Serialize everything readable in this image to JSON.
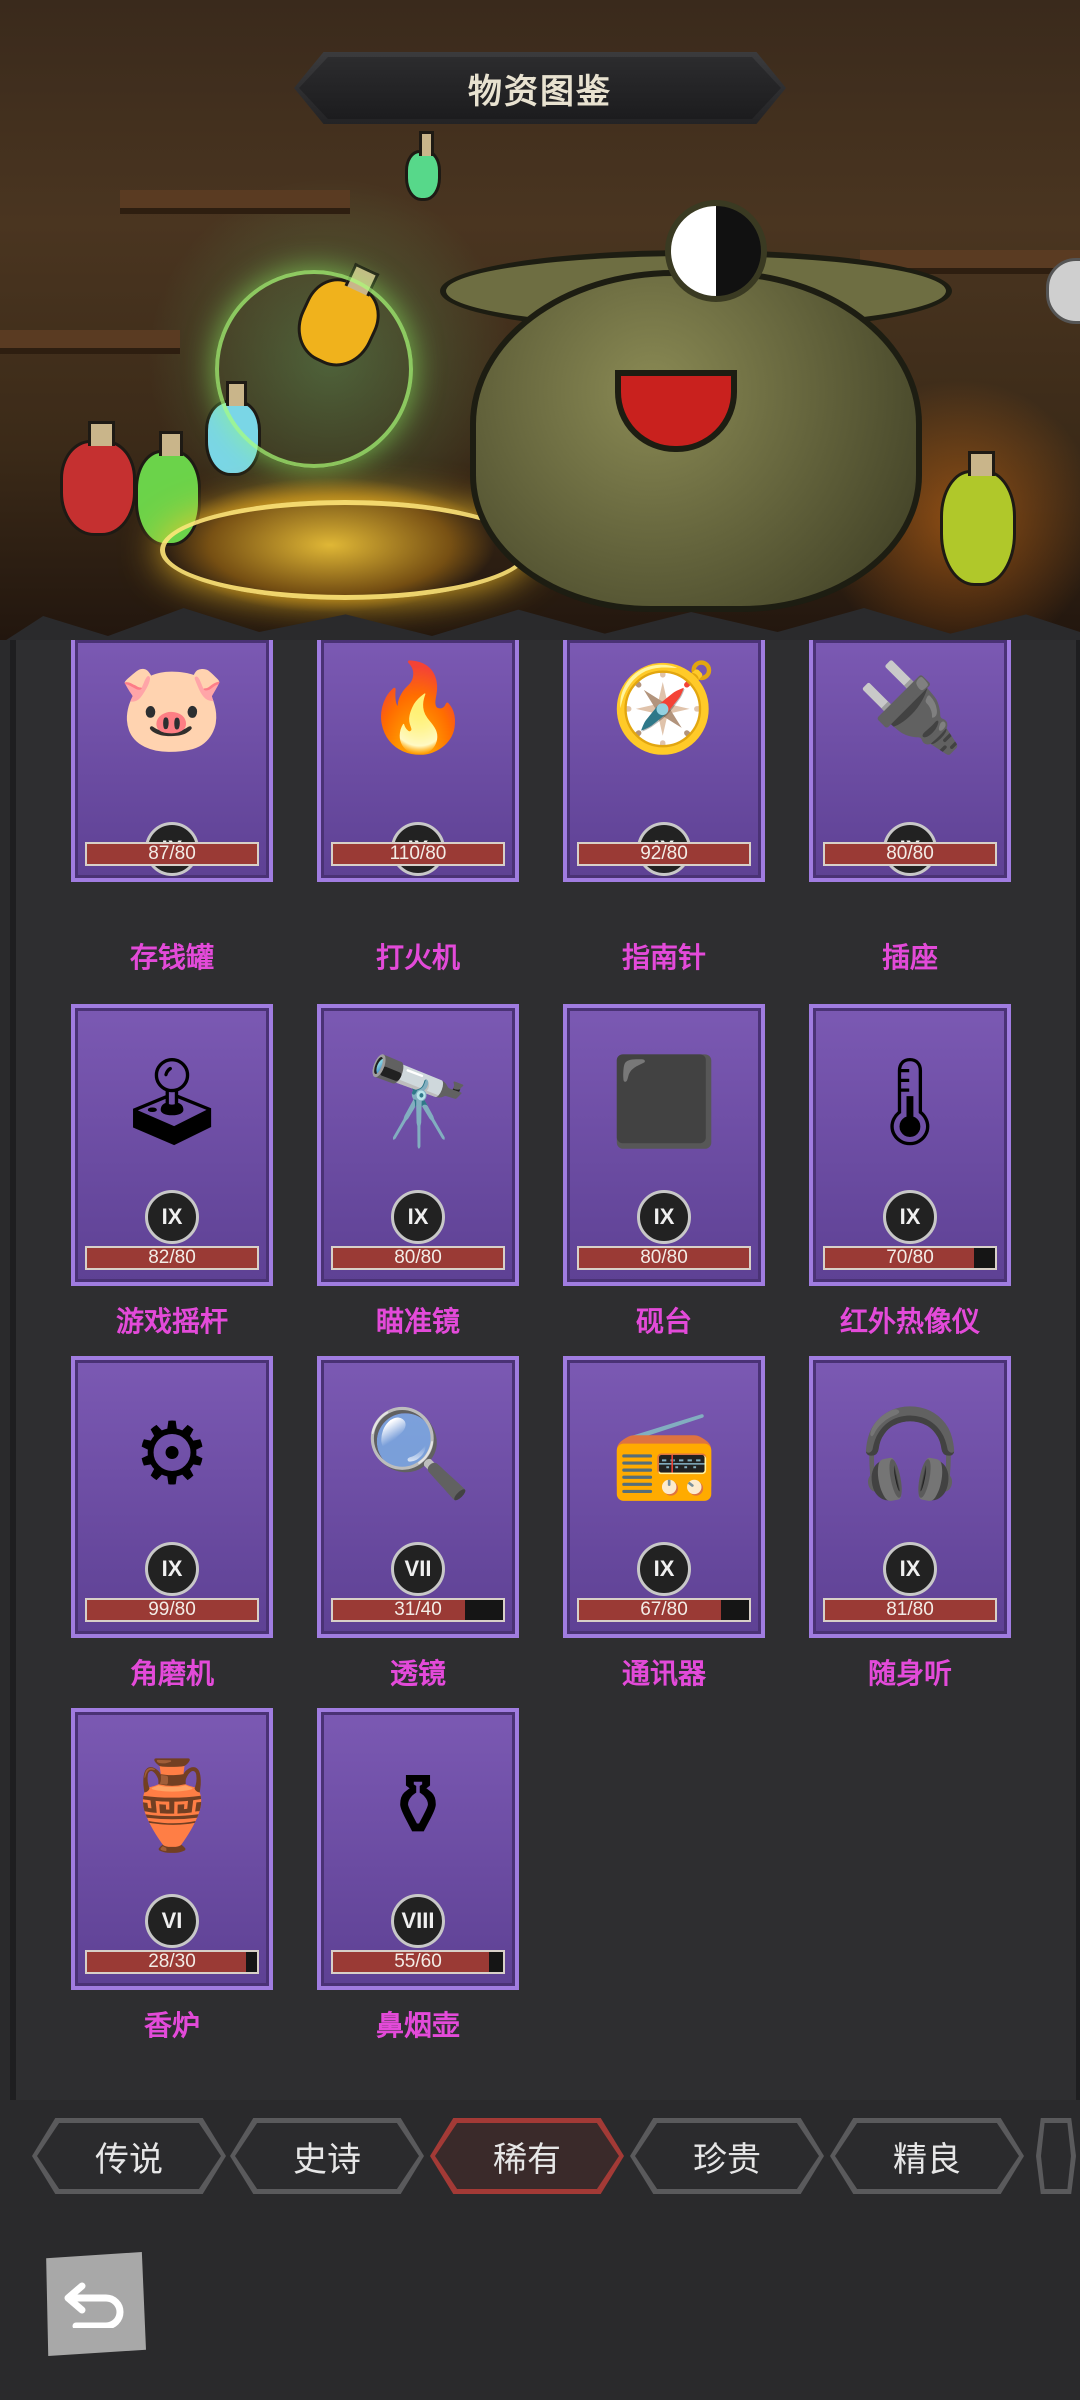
{
  "header": {
    "title": "物资图鉴"
  },
  "items": [
    {
      "name": "存钱罐",
      "tier": "IX",
      "progress": "87/80",
      "current": 87,
      "max": 80,
      "icon": "piggy-bank-icon",
      "glyph": "🐷"
    },
    {
      "name": "打火机",
      "tier": "IX",
      "progress": "110/80",
      "current": 110,
      "max": 80,
      "icon": "lighter-icon",
      "glyph": "🔥"
    },
    {
      "name": "指南针",
      "tier": "IX",
      "progress": "92/80",
      "current": 92,
      "max": 80,
      "icon": "compass-icon",
      "glyph": "🧭"
    },
    {
      "name": "插座",
      "tier": "IX",
      "progress": "80/80",
      "current": 80,
      "max": 80,
      "icon": "power-socket-icon",
      "glyph": "🔌"
    },
    {
      "name": "游戏摇杆",
      "tier": "IX",
      "progress": "82/80",
      "current": 82,
      "max": 80,
      "icon": "joystick-icon",
      "glyph": "🕹"
    },
    {
      "name": "瞄准镜",
      "tier": "IX",
      "progress": "80/80",
      "current": 80,
      "max": 80,
      "icon": "scope-icon",
      "glyph": "🔭"
    },
    {
      "name": "砚台",
      "tier": "IX",
      "progress": "80/80",
      "current": 80,
      "max": 80,
      "icon": "inkstone-icon",
      "glyph": "⬛"
    },
    {
      "name": "红外热像仪",
      "tier": "IX",
      "progress": "70/80",
      "current": 70,
      "max": 80,
      "icon": "thermal-camera-icon",
      "glyph": "🌡"
    },
    {
      "name": "角磨机",
      "tier": "IX",
      "progress": "99/80",
      "current": 99,
      "max": 80,
      "icon": "angle-grinder-icon",
      "glyph": "⚙"
    },
    {
      "name": "透镜",
      "tier": "VII",
      "progress": "31/40",
      "current": 31,
      "max": 40,
      "icon": "lens-icon",
      "glyph": "🔍"
    },
    {
      "name": "通讯器",
      "tier": "IX",
      "progress": "67/80",
      "current": 67,
      "max": 80,
      "icon": "walkie-talkie-icon",
      "glyph": "📻"
    },
    {
      "name": "随身听",
      "tier": "IX",
      "progress": "81/80",
      "current": 81,
      "max": 80,
      "icon": "walkman-icon",
      "glyph": "🎧"
    },
    {
      "name": "香炉",
      "tier": "VI",
      "progress": "28/30",
      "current": 28,
      "max": 30,
      "icon": "incense-burner-icon",
      "glyph": "🏺"
    },
    {
      "name": "鼻烟壶",
      "tier": "VIII",
      "progress": "55/60",
      "current": 55,
      "max": 60,
      "icon": "snuff-bottle-icon",
      "glyph": "⚱"
    }
  ],
  "tabs": [
    {
      "label": "传说",
      "active": false
    },
    {
      "label": "史诗",
      "active": false
    },
    {
      "label": "稀有",
      "active": true
    },
    {
      "label": "珍贵",
      "active": false
    },
    {
      "label": "精良",
      "active": false
    }
  ],
  "colors": {
    "card": "#6b4ea3",
    "card_border": "#a07ce0",
    "name_text": "#e34ad9",
    "bar_fill": "#9a3a35",
    "active_tab": "#a33a36"
  }
}
